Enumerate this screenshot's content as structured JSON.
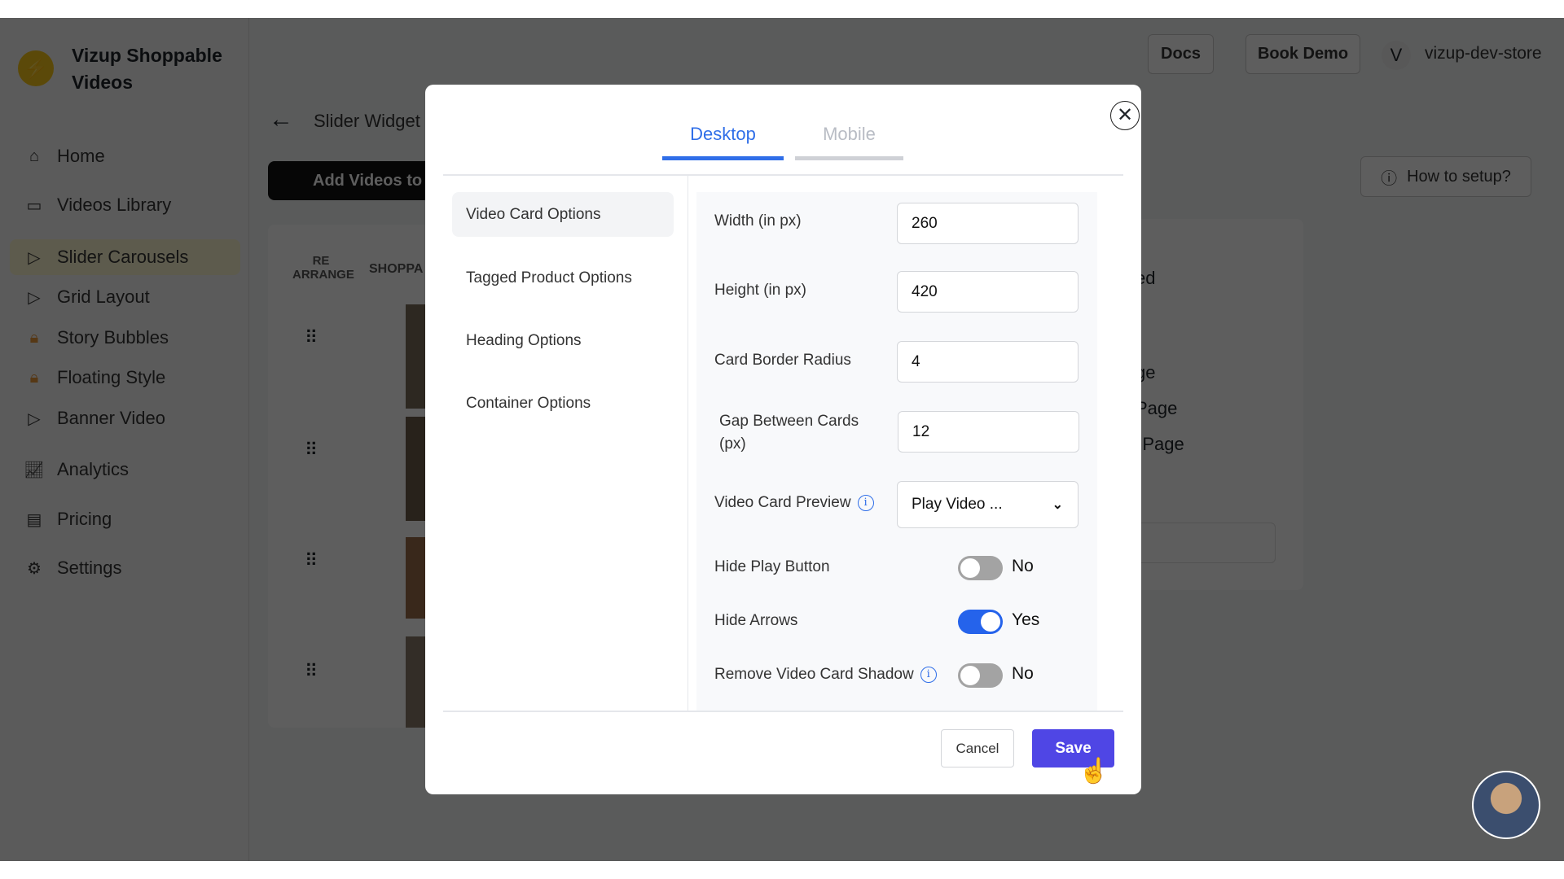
{
  "app": {
    "brand": "Vizup Shoppable Videos",
    "accent": "#2f6ee8",
    "save_color": "#4f46e5"
  },
  "sidebar": {
    "items": [
      {
        "label": "Home",
        "icon": "home-icon"
      },
      {
        "label": "Videos Library",
        "icon": "video-camera-icon"
      },
      {
        "label": "Slider Carousels",
        "icon": "play-circle-icon",
        "active": true
      },
      {
        "label": "Grid Layout",
        "icon": "play-circle-icon"
      },
      {
        "label": "Story Bubbles",
        "icon": "lock-icon"
      },
      {
        "label": "Floating Style",
        "icon": "lock-icon"
      },
      {
        "label": "Banner Video",
        "icon": "play-circle-icon"
      },
      {
        "label": "Analytics",
        "icon": "chart-board-icon"
      },
      {
        "label": "Pricing",
        "icon": "credit-card-icon"
      },
      {
        "label": "Settings",
        "icon": "gear-icon"
      }
    ]
  },
  "header": {
    "docs": "Docs",
    "book_demo": "Book Demo",
    "avatar_letter": "V",
    "store": "vizup-dev-store"
  },
  "page": {
    "title": "Slider Widget",
    "add_videos": "Add Videos to",
    "how_to": "How to setup?",
    "col_rearrange": "RE ARRANGE",
    "col_shoppable": "SHOPPA",
    "right_card": [
      "ed",
      "ge",
      "Page",
      "n Page"
    ]
  },
  "modal": {
    "tabs": [
      {
        "label": "Desktop",
        "active": true
      },
      {
        "label": "Mobile",
        "active": false
      }
    ],
    "sections": [
      "Video Card Options",
      "Tagged Product Options",
      "Heading Options",
      "Container Options"
    ],
    "fields": {
      "width": {
        "label": "Width (in px)",
        "value": "260"
      },
      "height": {
        "label": "Height (in px)",
        "value": "420"
      },
      "radius": {
        "label": "Card Border Radius",
        "value": "4"
      },
      "gap": {
        "label": "Gap Between Cards (px)",
        "value": "12"
      },
      "preview": {
        "label": "Video Card Preview",
        "value": "Play Video ..."
      },
      "hide_play": {
        "label": "Hide Play Button",
        "value": "No",
        "on": false
      },
      "hide_arrows": {
        "label": "Hide Arrows",
        "value": "Yes",
        "on": true
      },
      "remove_shadow": {
        "label": "Remove Video Card Shadow",
        "value": "No",
        "on": false
      }
    },
    "cancel": "Cancel",
    "save": "Save"
  }
}
